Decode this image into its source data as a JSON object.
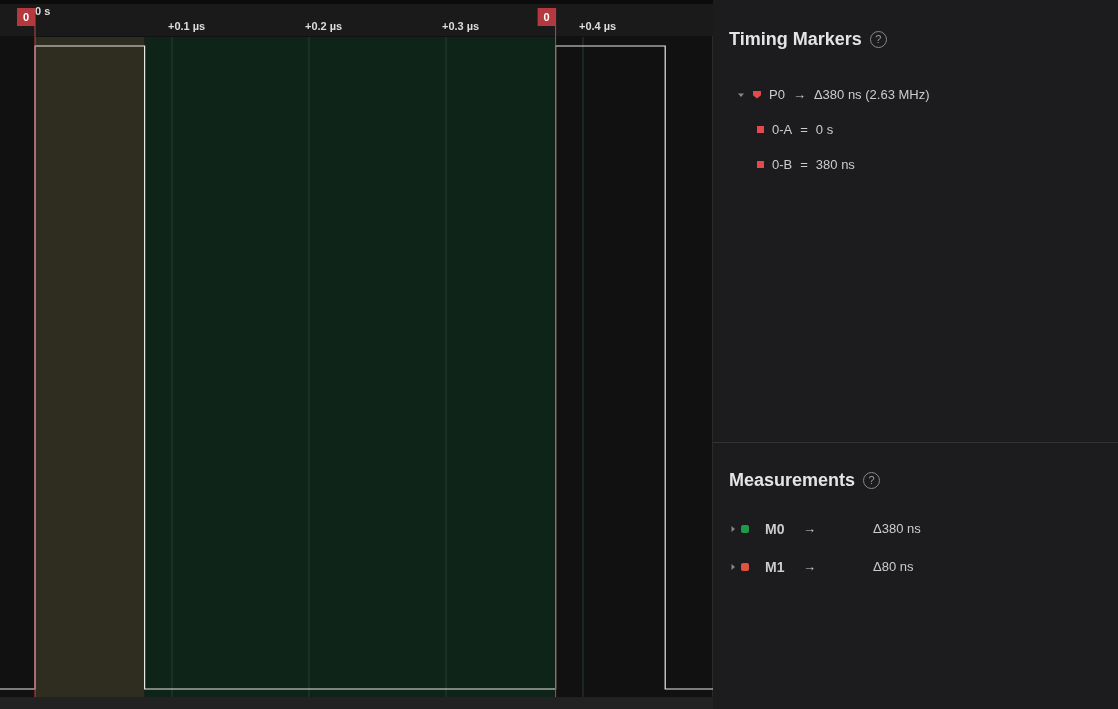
{
  "timeline": {
    "origin_label": "0 s",
    "ticks": [
      "+0.1 µs",
      "+0.2 µs",
      "+0.3 µs",
      "+0.4 µs"
    ],
    "marker_flags": [
      "0",
      "0"
    ]
  },
  "timing_markers": {
    "title": "Timing Markers",
    "help": "?",
    "pairs": [
      {
        "name": "P0",
        "expanded": true,
        "arrow": "→",
        "delta": "Δ380 ns (2.63 MHz)",
        "color": "#e5484d",
        "markers": [
          {
            "name": "0-A",
            "equals": "=",
            "value": "0 s"
          },
          {
            "name": "0-B",
            "equals": "=",
            "value": "380 ns"
          }
        ]
      }
    ]
  },
  "measurements": {
    "title": "Measurements",
    "help": "?",
    "items": [
      {
        "name": "M0",
        "expanded": false,
        "arrow": "→",
        "value": "Δ380 ns",
        "color": "#1e9a48"
      },
      {
        "name": "M1",
        "expanded": false,
        "arrow": "→",
        "value": "Δ80 ns",
        "color": "#e0533f"
      }
    ]
  }
}
